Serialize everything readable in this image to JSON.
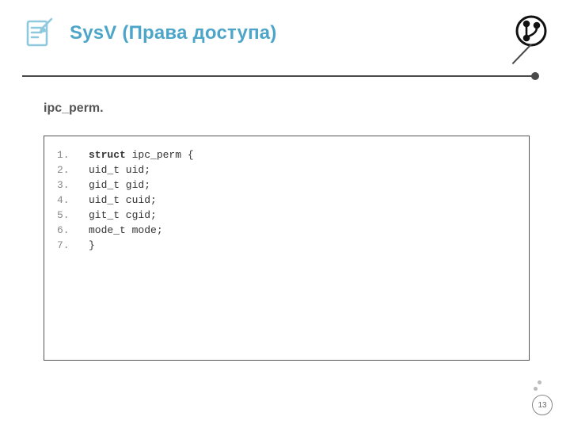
{
  "header": {
    "title": "SysV (Права доступа)"
  },
  "subtitle": "ipc_perm.",
  "code": {
    "lines": [
      {
        "n": "1.",
        "kw": "struct",
        "rest": " ipc_perm {"
      },
      {
        "n": "2.",
        "kw": "",
        "rest": "uid_t uid;"
      },
      {
        "n": "3.",
        "kw": "",
        "rest": "gid_t gid;"
      },
      {
        "n": "4.",
        "kw": "",
        "rest": "uid_t cuid;"
      },
      {
        "n": "5.",
        "kw": "",
        "rest": "git_t cgid;"
      },
      {
        "n": "6.",
        "kw": "",
        "rest": "mode_t mode;"
      },
      {
        "n": "7.",
        "kw": "",
        "rest": "}"
      }
    ]
  },
  "page_number": "13"
}
